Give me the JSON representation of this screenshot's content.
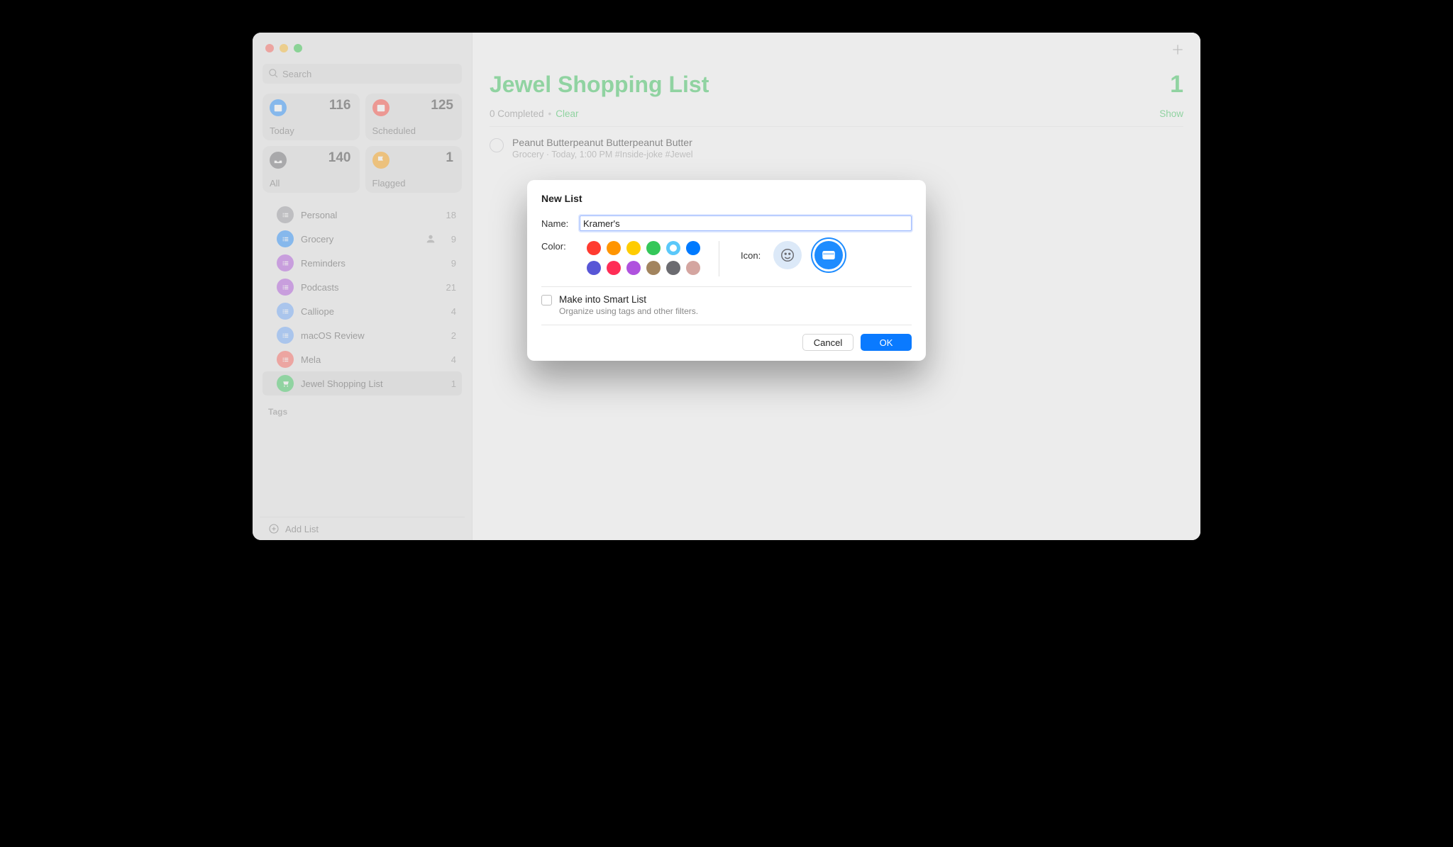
{
  "search": {
    "placeholder": "Search"
  },
  "stats": {
    "today": {
      "label": "Today",
      "count": "116"
    },
    "scheduled": {
      "label": "Scheduled",
      "count": "125"
    },
    "all": {
      "label": "All",
      "count": "140"
    },
    "flagged": {
      "label": "Flagged",
      "count": "1"
    }
  },
  "lists": [
    {
      "label": "Personal",
      "count": "18",
      "color": "b-grey",
      "shared": false
    },
    {
      "label": "Grocery",
      "count": "9",
      "color": "b-blue",
      "shared": true
    },
    {
      "label": "Reminders",
      "count": "9",
      "color": "b-purple",
      "shared": false
    },
    {
      "label": "Podcasts",
      "count": "21",
      "color": "b-purple",
      "shared": false
    },
    {
      "label": "Calliope",
      "count": "4",
      "color": "b-blue2",
      "shared": false
    },
    {
      "label": "macOS Review",
      "count": "2",
      "color": "b-blue2",
      "shared": false
    },
    {
      "label": "Mela",
      "count": "4",
      "color": "b-red",
      "shared": false
    },
    {
      "label": "Jewel Shopping List",
      "count": "1",
      "color": "b-green",
      "shared": false,
      "selected": true,
      "cart": true
    }
  ],
  "tags_header": "Tags",
  "add_list_label": "Add List",
  "main": {
    "title": "Jewel Shopping List",
    "count": "1",
    "completed_text": "0 Completed",
    "clear_label": "Clear",
    "show_label": "Show",
    "reminder": {
      "title": "Peanut Butterpeanut Butterpeanut Butter",
      "meta": "Grocery · Today, 1:00 PM #Inside-joke #Jewel"
    }
  },
  "sheet": {
    "title": "New List",
    "name_label": "Name:",
    "name_value": "Kramer's",
    "color_label": "Color:",
    "icon_label": "Icon:",
    "colors": [
      "#ff3b30",
      "#ff9500",
      "#ffcc00",
      "#34c759",
      "#5ac8fa",
      "#007aff",
      "#5856d6",
      "#ff2d55",
      "#af52de",
      "#a2845e",
      "#6b6b70",
      "#d4a5a0"
    ],
    "selected_color_index": 4,
    "smart_title": "Make into Smart List",
    "smart_desc": "Organize using tags and other filters.",
    "cancel_label": "Cancel",
    "ok_label": "OK"
  }
}
